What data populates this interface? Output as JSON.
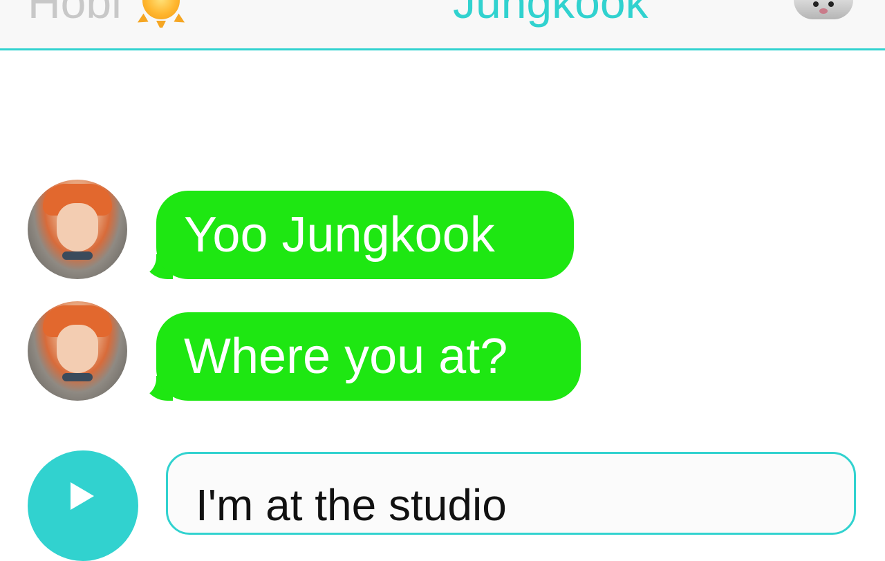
{
  "header": {
    "left_name": "Hobi",
    "left_emoji": "sun-icon",
    "right_name": "Jungkook",
    "right_emoji": "hamster-icon"
  },
  "messages": [
    {
      "sender": "Hobi",
      "text": "Yoo Jungkook"
    },
    {
      "sender": "Hobi",
      "text": "Where you at?"
    }
  ],
  "composer": {
    "text": "I'm at the studio"
  },
  "colors": {
    "accent": "#31d2cf",
    "bubble": "#1ee712",
    "header_left_text": "#c8c8c8"
  }
}
